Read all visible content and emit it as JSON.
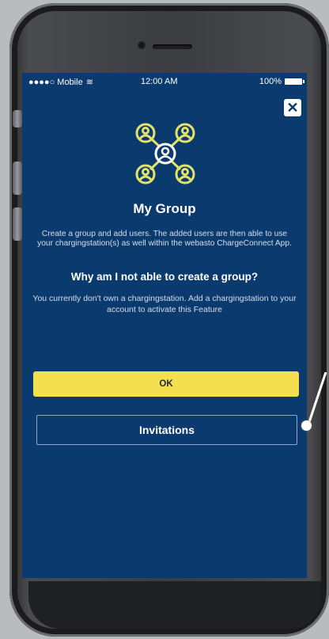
{
  "status_bar": {
    "carrier": "●●●●○ Mobile",
    "time": "12:00 AM",
    "battery": "100%"
  },
  "close_label": "✕",
  "group": {
    "title": "My Group",
    "description": "Create a group and add users. The added users are then able to use your chargingstation(s) as well within the webasto ChargeConnect App.",
    "question": "Why am I not able to create a group?",
    "reason": "You currently don't own a chargingstation. Add a chargingstation to your account to activate this Feature"
  },
  "buttons": {
    "ok": "OK",
    "invitations": "Invitations"
  },
  "colors": {
    "screen_bg": "#0b3a6e",
    "accent_yellow": "#f4e04f",
    "icon_yellow": "#e3e36a"
  }
}
